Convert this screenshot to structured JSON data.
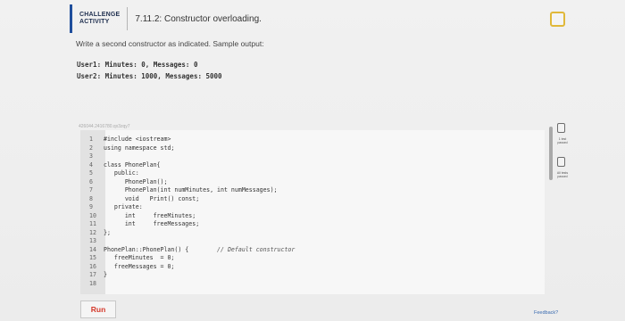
{
  "header": {
    "badge_line1": "CHALLENGE",
    "badge_line2": "ACTIVITY",
    "title": "7.11.2: Constructor overloading."
  },
  "instruction": "Write a second constructor as indicated. Sample output:",
  "sample_output": [
    "User1: Minutes: 0, Messages: 0",
    "User2: Minutes: 1000, Messages: 5000"
  ],
  "faded_id": "426044.2416780.qx3zqy7",
  "code_lines": [
    {
      "n": "1",
      "text": "#include <iostream>"
    },
    {
      "n": "2",
      "text": "using namespace std;"
    },
    {
      "n": "3",
      "text": ""
    },
    {
      "n": "4",
      "text": "class PhonePlan{"
    },
    {
      "n": "5",
      "text": "   public:"
    },
    {
      "n": "6",
      "text": "      PhonePlan();"
    },
    {
      "n": "7",
      "text": "      PhonePlan(int numMinutes, int numMessages);"
    },
    {
      "n": "8",
      "text": "      void   Print() const;"
    },
    {
      "n": "9",
      "text": "   private:"
    },
    {
      "n": "10",
      "text": "      int     freeMinutes;"
    },
    {
      "n": "11",
      "text": "      int     freeMessages;"
    },
    {
      "n": "12",
      "text": "};"
    },
    {
      "n": "13",
      "text": ""
    },
    {
      "n": "14",
      "text": "PhonePlan::PhonePlan() {",
      "comment": "// Default constructor"
    },
    {
      "n": "15",
      "text": "   freeMinutes  = 0;"
    },
    {
      "n": "16",
      "text": "   freeMessages = 0;"
    },
    {
      "n": "17",
      "text": "}"
    },
    {
      "n": "18",
      "text": ""
    }
  ],
  "side": {
    "label1": "1 test passed",
    "label2": "All tests passed"
  },
  "run_label": "Run",
  "feedback_label": "Feedback?"
}
